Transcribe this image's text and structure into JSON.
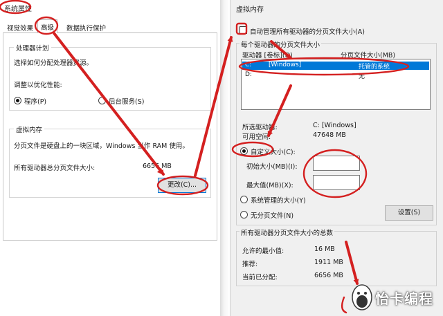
{
  "left_dialog": {
    "title": "系统属性",
    "tabs": [
      {
        "label": "视觉效果"
      },
      {
        "label": "高级"
      },
      {
        "label": "数据执行保护"
      }
    ],
    "processor_group": {
      "title": "处理器计划",
      "description": "选择如何分配处理器资源。",
      "adjust_label": "调整以优化性能:",
      "radio_programs": "程序(P)",
      "radio_background": "后台服务(S)",
      "selected": "程序(P)"
    },
    "vm_group": {
      "title": "虚拟内存",
      "description": "分页文件是硬盘上的一块区域，Windows 当作 RAM 使用。",
      "total_label": "所有驱动器总分页文件大小:",
      "total_value": "6656 MB",
      "change_button": "更改(C)..."
    }
  },
  "right_dialog": {
    "title": "虚拟内存",
    "auto_manage_label": "自动管理所有驱动器的分页文件大小(A)",
    "auto_manage_checked": false,
    "per_drive_group": {
      "title": "每个驱动器的分页文件大小",
      "col_drive": "驱动器 [卷标](D)",
      "col_size": "分页文件大小(MB)",
      "rows": [
        {
          "drive": "C:",
          "label": "[Windows]",
          "size": "托管的系统",
          "selected": true
        },
        {
          "drive": "D:",
          "label": "",
          "size": "无",
          "selected": false
        }
      ],
      "selected_drive_label": "所选驱动器:",
      "selected_drive_value": "C:  [Windows]",
      "free_space_label": "可用空间:",
      "free_space_value": "47648 MB",
      "radio_custom": "自定义大小(C):",
      "initial_size_label": "初始大小(MB)(I):",
      "initial_size_value": "",
      "max_size_label": "最大值(MB)(X):",
      "max_size_value": "",
      "radio_system": "系统管理的大小(Y)",
      "radio_none": "无分页文件(N)",
      "selected_option": "自定义大小(C):",
      "set_button": "设置(S)"
    },
    "totals_group": {
      "title": "所有驱动器分页文件大小的总数",
      "min_label": "允许的最小值:",
      "min_value": "16 MB",
      "recommended_label": "推荐:",
      "recommended_value": "1911 MB",
      "current_label": "当前已分配:",
      "current_value": "6656 MB"
    }
  },
  "watermark": {
    "text": "怡卡编程",
    "icon": "mouse-logo-icon"
  },
  "colors": {
    "annotation_red": "#d42020",
    "selection_blue": "#0078d7",
    "dialog_bg": "#f0f0f0"
  }
}
